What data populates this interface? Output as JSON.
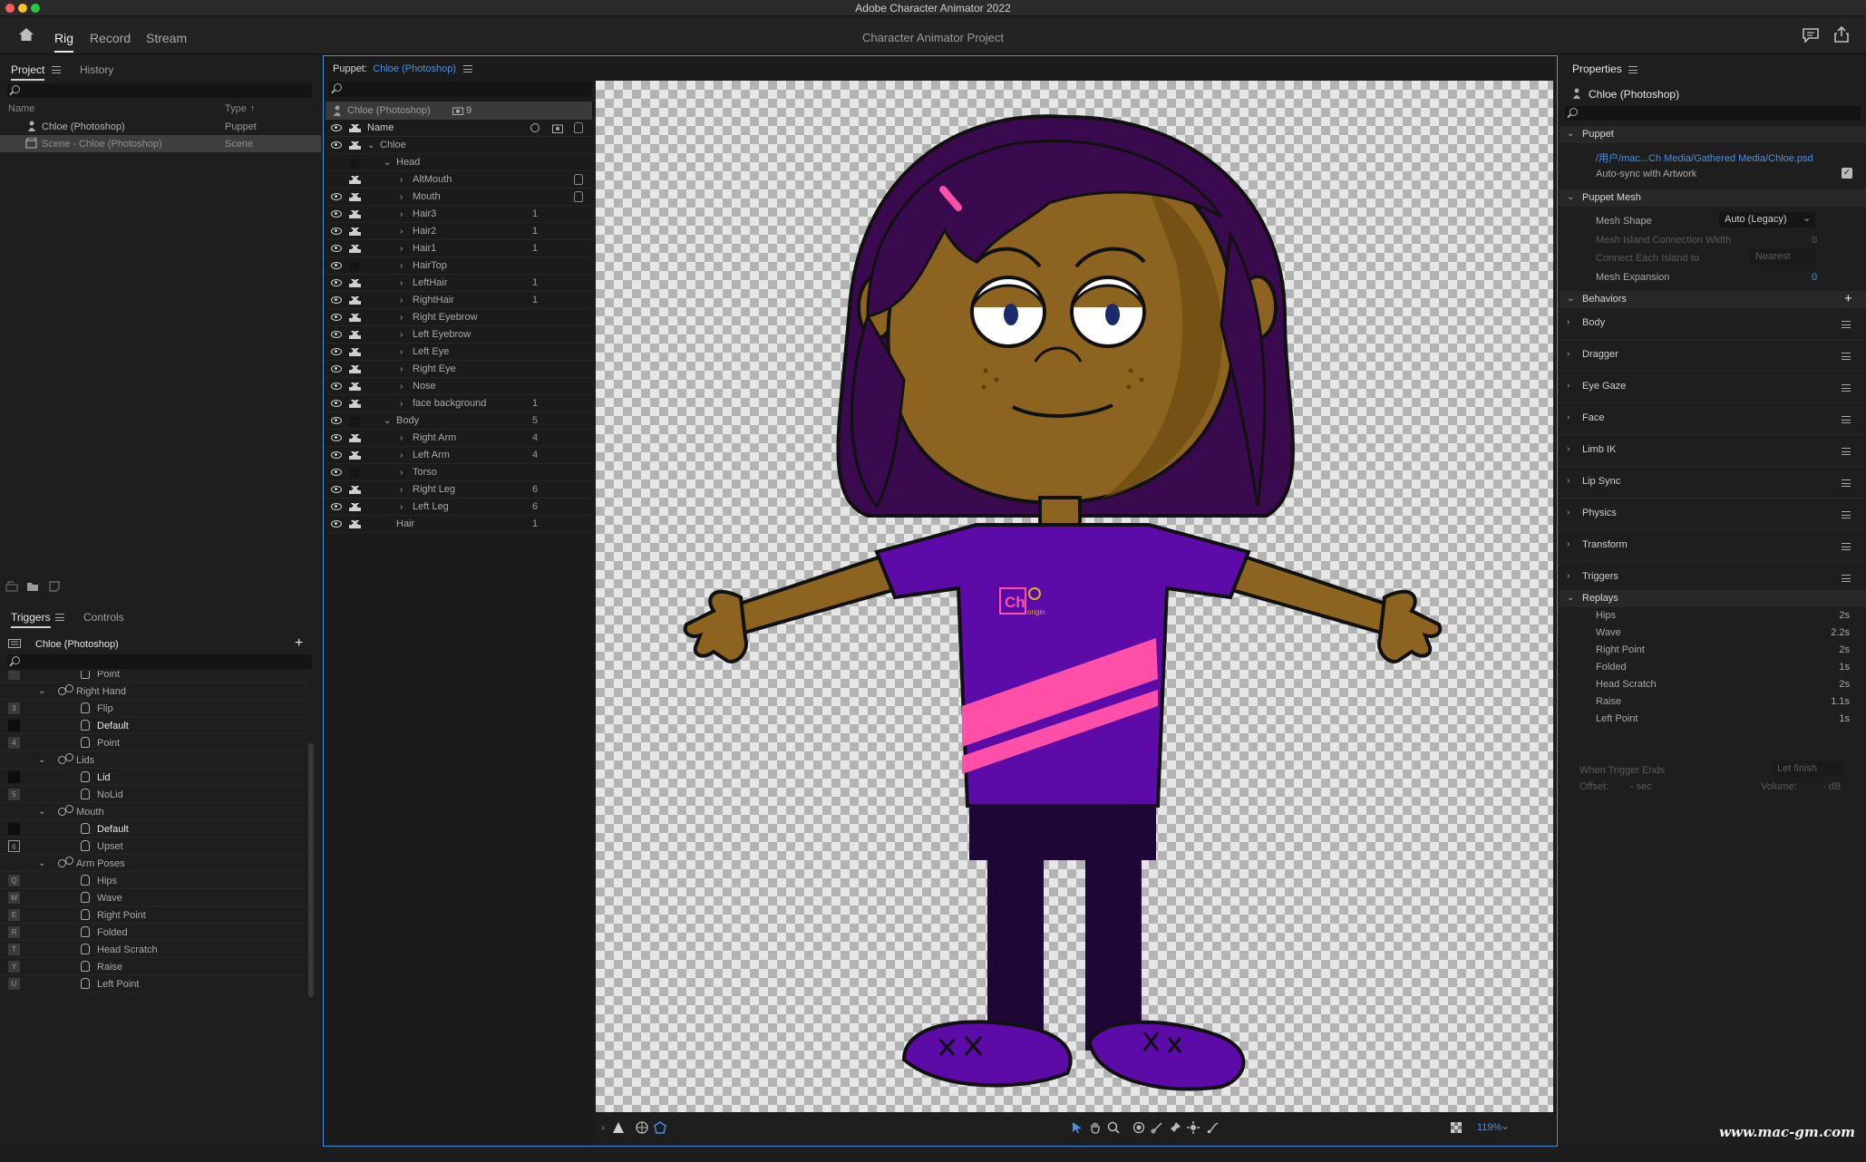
{
  "window": {
    "title": "Adobe Character Animator 2022"
  },
  "app": {
    "modes": [
      "Rig",
      "Record",
      "Stream"
    ],
    "project_title": "Character Animator Project"
  },
  "project_panel": {
    "tabs": [
      "Project",
      "History"
    ],
    "columns": {
      "name": "Name",
      "type": "Type"
    },
    "items": [
      {
        "name": "Chloe (Photoshop)",
        "type": "Puppet"
      },
      {
        "name": "Scene - Chloe (Photoshop)",
        "type": "Scene"
      }
    ]
  },
  "triggers_panel": {
    "tabs": [
      "Triggers",
      "Controls"
    ],
    "puppet": "Chloe (Photoshop)",
    "rows": [
      {
        "key": "",
        "name": "Point",
        "kind": "pose",
        "indent": 2
      },
      {
        "key": "",
        "name": "Right Hand",
        "kind": "group",
        "indent": 1
      },
      {
        "key": "3",
        "name": "Flip",
        "kind": "pose",
        "indent": 2
      },
      {
        "key": "",
        "name": "Default",
        "kind": "pose",
        "indent": 2,
        "bold": true
      },
      {
        "key": "4",
        "name": "Point",
        "kind": "pose",
        "indent": 2
      },
      {
        "key": "",
        "name": "Lids",
        "kind": "group",
        "indent": 1
      },
      {
        "key": "",
        "name": "Lid",
        "kind": "pose",
        "indent": 2,
        "bold": true
      },
      {
        "key": "5",
        "name": "NoLid",
        "kind": "pose",
        "indent": 2
      },
      {
        "key": "",
        "name": "Mouth",
        "kind": "group",
        "indent": 1
      },
      {
        "key": "",
        "name": "Default",
        "kind": "pose",
        "indent": 2,
        "bold": true
      },
      {
        "key": "6",
        "name": "Upset",
        "kind": "pose",
        "indent": 2
      },
      {
        "key": "",
        "name": "Arm Poses",
        "kind": "group",
        "indent": 1
      },
      {
        "key": "Q",
        "name": "Hips",
        "kind": "pose",
        "indent": 2
      },
      {
        "key": "W",
        "name": "Wave",
        "kind": "pose",
        "indent": 2
      },
      {
        "key": "E",
        "name": "Right Point",
        "kind": "pose",
        "indent": 2
      },
      {
        "key": "R",
        "name": "Folded",
        "kind": "pose",
        "indent": 2
      },
      {
        "key": "T",
        "name": "Head Scratch",
        "kind": "pose",
        "indent": 2
      },
      {
        "key": "Y",
        "name": "Raise",
        "kind": "pose",
        "indent": 2
      },
      {
        "key": "U",
        "name": "Left Point",
        "kind": "pose",
        "indent": 2
      }
    ]
  },
  "puppet_panel": {
    "title_prefix": "Puppet:",
    "title_name": "Chloe (Photoshop)",
    "puppet_label": "Chloe (Photoshop)",
    "count": "9",
    "name_header": "Name",
    "zoom": "119%",
    "layers": [
      {
        "name": "Chloe",
        "depth": 0,
        "open": true,
        "count": ""
      },
      {
        "name": "Head",
        "depth": 1,
        "open": true,
        "count": "",
        "noeye": true,
        "nocrown": true
      },
      {
        "name": "AltMouth",
        "depth": 2,
        "count": "",
        "noeye": true,
        "hand": true
      },
      {
        "name": "Mouth",
        "depth": 2,
        "count": "",
        "hand": true
      },
      {
        "name": "Hair3",
        "depth": 2,
        "count": "1"
      },
      {
        "name": "Hair2",
        "depth": 2,
        "count": "1"
      },
      {
        "name": "Hair1",
        "depth": 2,
        "count": "1"
      },
      {
        "name": "HairTop",
        "depth": 2,
        "count": "",
        "nocrown": true
      },
      {
        "name": "LeftHair",
        "depth": 2,
        "count": "1"
      },
      {
        "name": "RightHair",
        "depth": 2,
        "count": "1"
      },
      {
        "name": "Right Eyebrow",
        "depth": 2,
        "count": ""
      },
      {
        "name": "Left Eyebrow",
        "depth": 2,
        "count": ""
      },
      {
        "name": "Left Eye",
        "depth": 2,
        "count": ""
      },
      {
        "name": "Right Eye",
        "depth": 2,
        "count": ""
      },
      {
        "name": "Nose",
        "depth": 2,
        "count": ""
      },
      {
        "name": "face background",
        "depth": 2,
        "count": "1"
      },
      {
        "name": "Body",
        "depth": 1,
        "open": true,
        "count": "5",
        "nocrown": true
      },
      {
        "name": "Right Arm",
        "depth": 2,
        "count": "4"
      },
      {
        "name": "Left Arm",
        "depth": 2,
        "count": "4"
      },
      {
        "name": "Torso",
        "depth": 2,
        "count": "",
        "nocrown": true
      },
      {
        "name": "Right Leg",
        "depth": 2,
        "count": "6"
      },
      {
        "name": "Left Leg",
        "depth": 2,
        "count": "6"
      },
      {
        "name": "Hair",
        "depth": 1,
        "leaf": true,
        "count": "1"
      }
    ],
    "artwork": {
      "shirt_logo": "Ch",
      "shirt_logo_sub": "origin"
    }
  },
  "properties_panel": {
    "title": "Properties",
    "puppet": "Chloe (Photoshop)",
    "puppet_section": "Puppet",
    "path": "/用户/mac...Ch Media/Gathered Media/Chloe.psd",
    "autosync_label": "Auto-sync with Artwork",
    "mesh_section": "Puppet Mesh",
    "mesh_shape_label": "Mesh Shape",
    "mesh_shape_value": "Auto (Legacy)",
    "mesh_island_label": "Mesh Island Connection Width",
    "mesh_island_value": "0",
    "connect_label": "Connect Each Island to",
    "connect_value": "Nearest",
    "expansion_label": "Mesh Expansion",
    "expansion_value": "0",
    "behaviors_section": "Behaviors",
    "behaviors": [
      "Body",
      "Dragger",
      "Eye Gaze",
      "Face",
      "Limb IK",
      "Lip Sync",
      "Physics",
      "Transform",
      "Triggers"
    ],
    "replays_section": "Replays",
    "replays": [
      {
        "name": "Hips",
        "dur": "2s"
      },
      {
        "name": "Wave",
        "dur": "2.2s"
      },
      {
        "name": "Right Point",
        "dur": "2s"
      },
      {
        "name": "Folded",
        "dur": "1s"
      },
      {
        "name": "Head Scratch",
        "dur": "2s"
      },
      {
        "name": "Raise",
        "dur": "1.1s"
      },
      {
        "name": "Left Point",
        "dur": "1s"
      }
    ],
    "when_ends_label": "When Trigger Ends",
    "when_ends_value": "Let finish",
    "offset_label": "Offset:",
    "offset_value": "- sec",
    "volume_label": "Volume:",
    "volume_value": "- dB"
  },
  "watermark": "www.mac-gm.com",
  "colors": {
    "accent": "#4a90e2",
    "hair": "#3a0a4f",
    "skin": "#8c6420",
    "shirt": "#5c0aa8",
    "stripe": "#ff4fa6",
    "pants": "#1e0636"
  }
}
